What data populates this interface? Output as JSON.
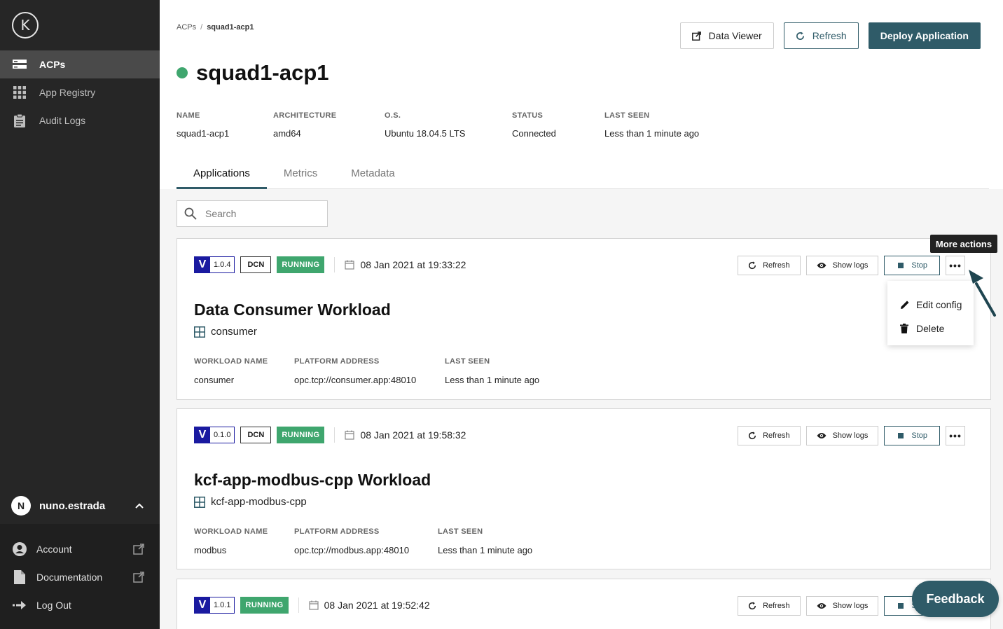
{
  "sidebar": {
    "logo_letter": "K",
    "items": [
      {
        "label": "ACPs",
        "icon": "server-icon",
        "active": true
      },
      {
        "label": "App Registry",
        "icon": "grid-icon",
        "active": false
      },
      {
        "label": "Audit Logs",
        "icon": "clipboard-icon",
        "active": false
      }
    ],
    "user": {
      "initial": "N",
      "name": "nuno.estrada"
    },
    "bottom": [
      {
        "label": "Account",
        "icon": "account-icon"
      },
      {
        "label": "Documentation",
        "icon": "document-icon"
      },
      {
        "label": "Log Out",
        "icon": "logout-icon"
      }
    ]
  },
  "breadcrumb": {
    "root": "ACPs",
    "sep": "/",
    "current": "squad1-acp1"
  },
  "header_actions": {
    "data_viewer": "Data Viewer",
    "refresh": "Refresh",
    "deploy": "Deploy Application"
  },
  "page": {
    "title": "squad1-acp1",
    "status_color": "#3fa66e",
    "meta": [
      {
        "label": "NAME",
        "value": "squad1-acp1"
      },
      {
        "label": "ARCHITECTURE",
        "value": "amd64"
      },
      {
        "label": "O.S.",
        "value": "Ubuntu 18.04.5 LTS"
      },
      {
        "label": "STATUS",
        "value": "Connected"
      },
      {
        "label": "LAST SEEN",
        "value": "Less than 1 minute ago"
      }
    ]
  },
  "tabs": [
    "Applications",
    "Metrics",
    "Metadata"
  ],
  "search": {
    "placeholder": "Search"
  },
  "card_actions": {
    "refresh": "Refresh",
    "show_logs": "Show logs",
    "stop": "Stop",
    "more": "•••"
  },
  "workloads": [
    {
      "badge": "V",
      "version": "1.0.4",
      "tag": "DCN",
      "status": "RUNNING",
      "date": "08 Jan 2021 at 19:33:22",
      "title": "Data Consumer Workload",
      "subtitle": "consumer",
      "meta": [
        {
          "label": "WORKLOAD NAME",
          "value": "consumer"
        },
        {
          "label": "PLATFORM ADDRESS",
          "value": "opc.tcp://consumer.app:48010"
        },
        {
          "label": "LAST SEEN",
          "value": "Less than 1 minute ago"
        }
      ]
    },
    {
      "badge": "V",
      "version": "0.1.0",
      "tag": "DCN",
      "status": "RUNNING",
      "date": "08 Jan 2021 at 19:58:32",
      "title": "kcf-app-modbus-cpp Workload",
      "subtitle": "kcf-app-modbus-cpp",
      "meta": [
        {
          "label": "WORKLOAD NAME",
          "value": "modbus"
        },
        {
          "label": "PLATFORM ADDRESS",
          "value": "opc.tcp://modbus.app:48010"
        },
        {
          "label": "LAST SEEN",
          "value": "Less than 1 minute ago"
        }
      ]
    },
    {
      "badge": "V",
      "version": "1.0.1",
      "status": "RUNNING",
      "date": "08 Jan 2021 at 19:52:42"
    }
  ],
  "tooltip": "More actions",
  "dropdown": [
    "Edit config",
    "Delete"
  ],
  "feedback": "Feedback",
  "colors": {
    "accent": "#2f5b68",
    "running": "#3fa66e",
    "badge": "#1a1aa0",
    "sidebar": "#262626"
  }
}
